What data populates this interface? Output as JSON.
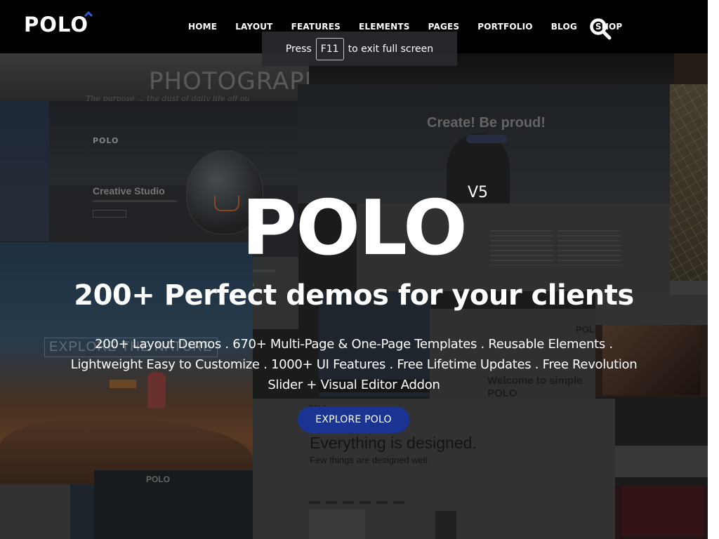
{
  "brand": {
    "logo_text": "POLO",
    "accent": "#2c5ad8"
  },
  "nav": {
    "items": [
      {
        "label": "HOME"
      },
      {
        "label": "LAYOUT"
      },
      {
        "label": "FEATURES"
      },
      {
        "label": "ELEMENTS"
      },
      {
        "label": "PAGES"
      },
      {
        "label": "PORTFOLIO"
      },
      {
        "label": "BLOG"
      },
      {
        "label": "SHOP"
      }
    ],
    "search_icon": "search-icon"
  },
  "fullscreen_notice": {
    "before": "Press",
    "key": "F11",
    "after": "to exit full screen"
  },
  "hero": {
    "title": "POLO",
    "version": "V5",
    "subtitle": "200+ Perfect demos for your clients",
    "description": "200+ Layout Demos . 670+ Multi-Page & One-Page Templates . Reusable Elements . Lightweight Easy to Customize . 1000+ UI Features . Free Lifetime Updates . Free Revolution Slider + Visual Editor Addon",
    "cta_label": "EXPLORE POLO",
    "cta_color": "#1a3591"
  },
  "background_previews": {
    "photography": {
      "title": "PHOTOGRAPHY",
      "tagline": "The purpose ... the dust of daily life off ou"
    },
    "creative": {
      "logo": "POLO",
      "title": "Creative Studio"
    },
    "proud": {
      "title": "Create! Be proud!"
    },
    "nature": {
      "title": "EXPLORE THE NATURE"
    },
    "welcome": {
      "title": "Welcome to simple POLO",
      "logo": "POL"
    },
    "designed": {
      "logo": "POLO",
      "title": "Everything is designed.",
      "subtitle": "Few things are designed well."
    },
    "bottom": {
      "logo": "POLO"
    }
  }
}
